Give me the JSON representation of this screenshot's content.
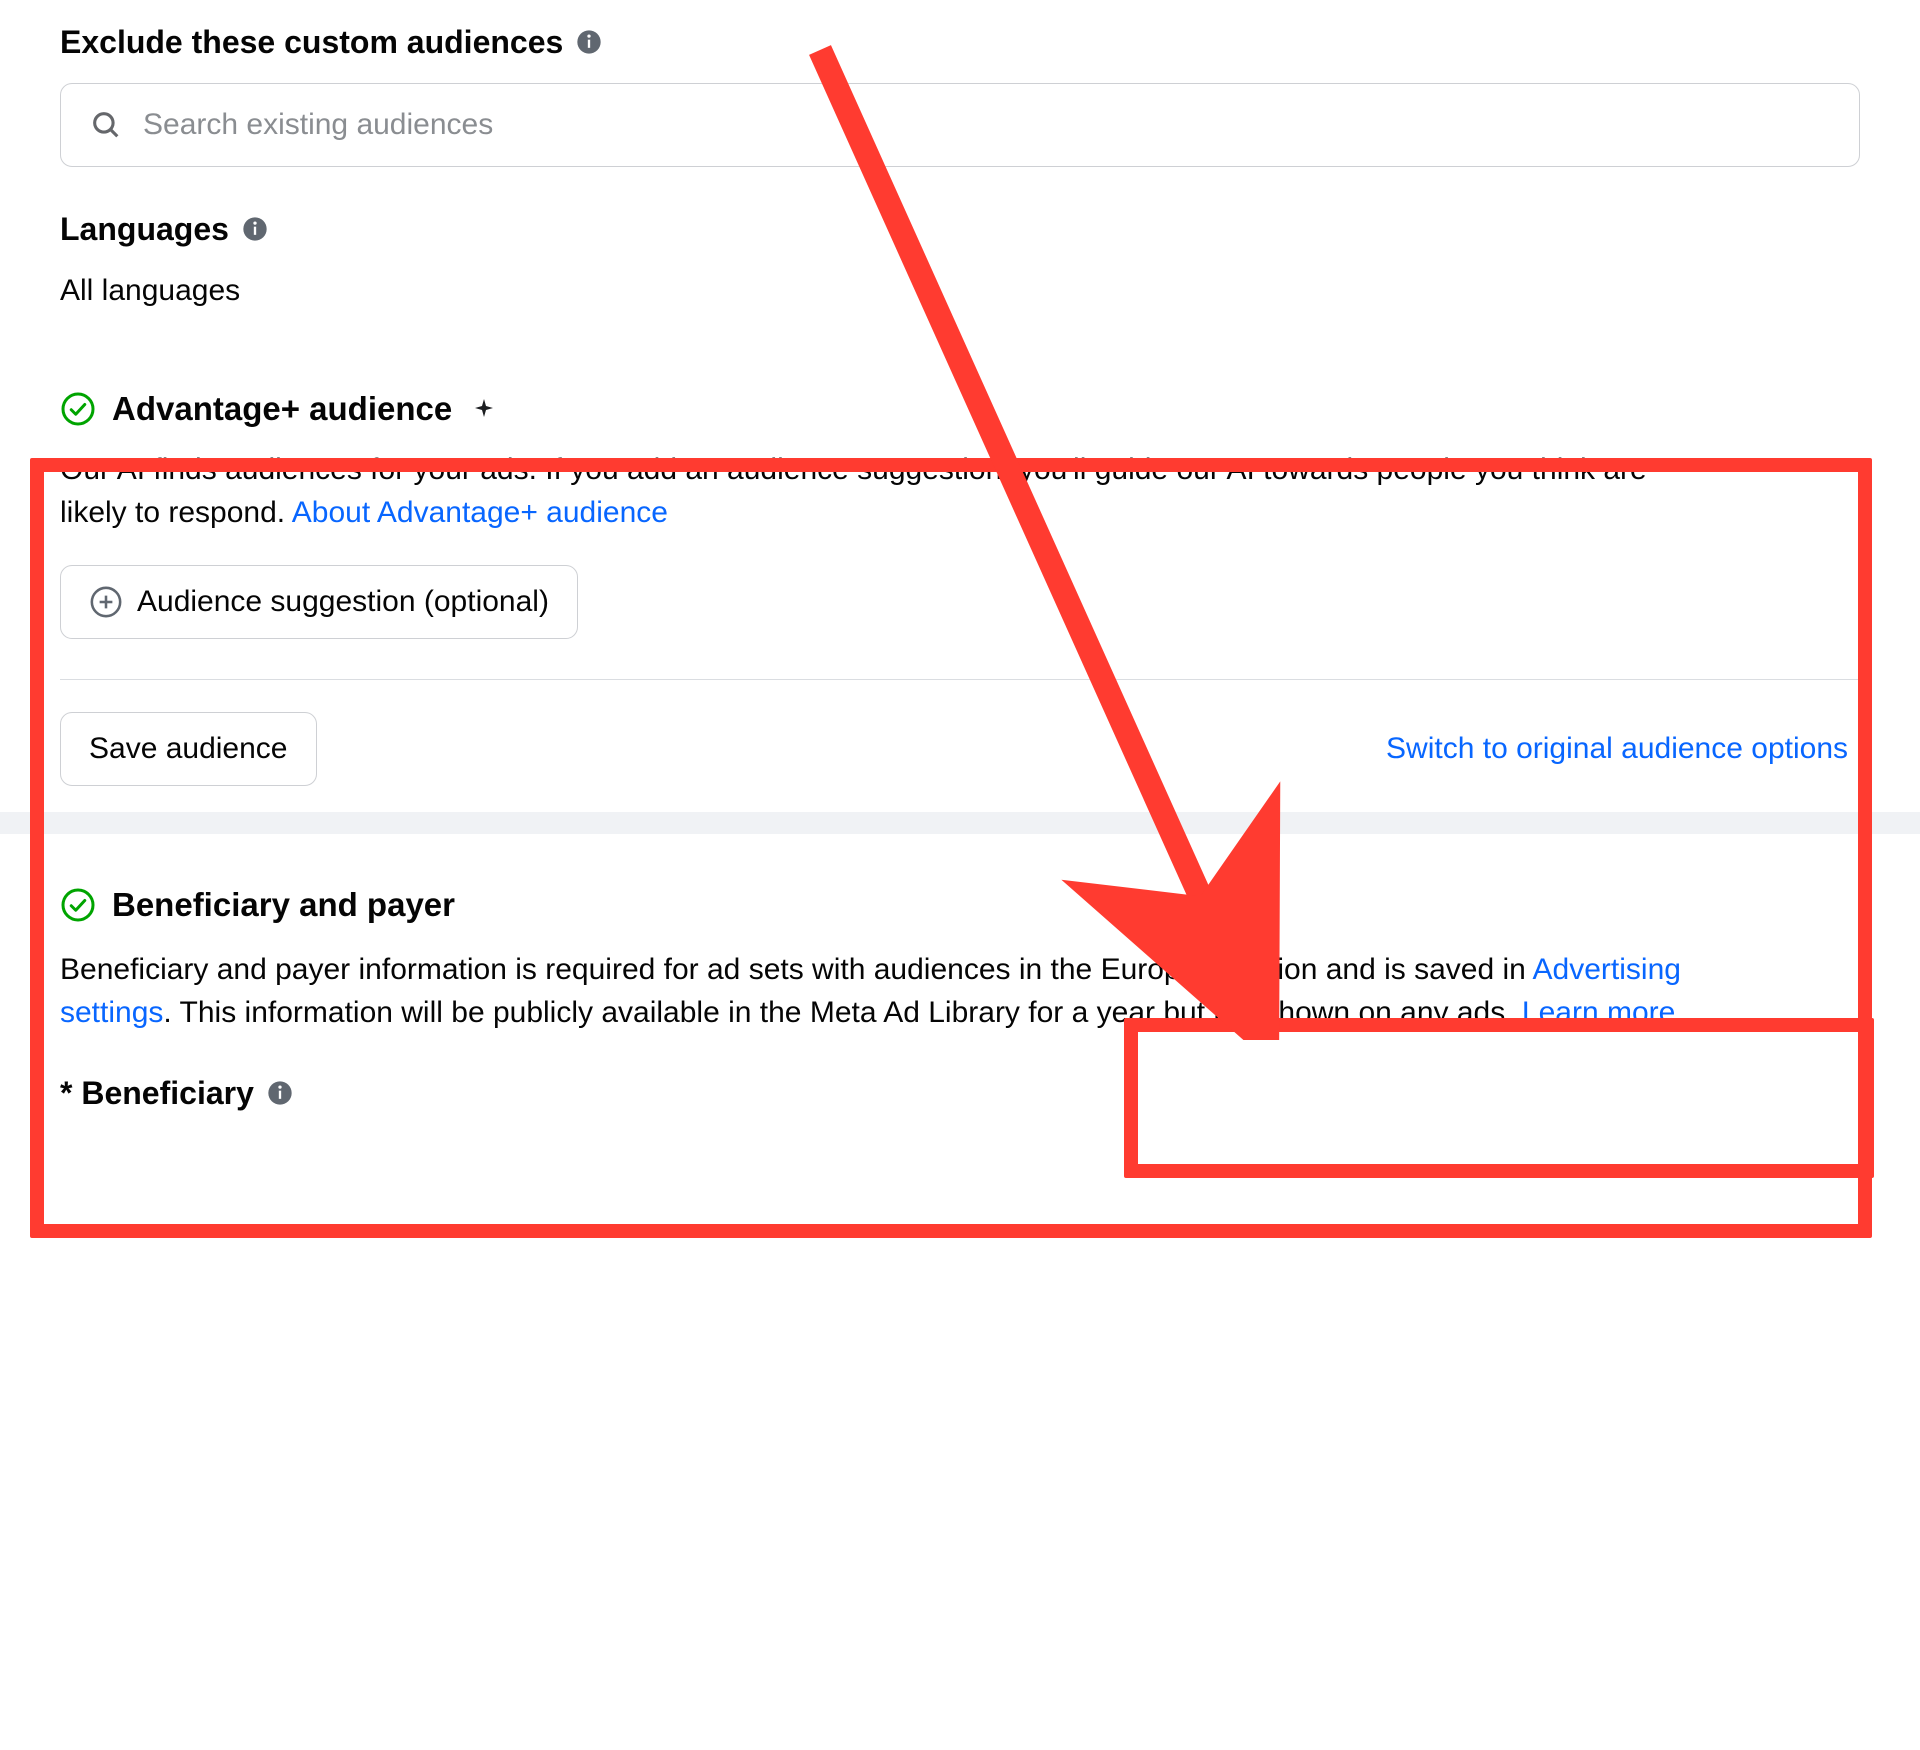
{
  "exclude": {
    "label": "Exclude these custom audiences",
    "placeholder": "Search existing audiences"
  },
  "languages": {
    "label": "Languages",
    "value": "All languages"
  },
  "advantage": {
    "title": "Advantage+ audience",
    "description_pre": "Our AI finds audiences for your ads. If you add an audience suggestion, you'll guide our AI towards people you think are likely to respond. ",
    "description_link": "About Advantage+ audience",
    "suggestion_btn": "Audience suggestion (optional)",
    "save_btn": "Save audience",
    "switch_link": "Switch to original audience options"
  },
  "beneficiary": {
    "title": "Beneficiary and payer",
    "body_1": "Beneficiary and payer information is required for ad sets with audiences in the European Union and is saved in ",
    "link_settings": "Advertising settings",
    "body_2": ". This information will be publicly available in the Meta Ad Library for a year but not shown on any ads. ",
    "link_learn": "Learn more",
    "field_label": "* Beneficiary"
  }
}
